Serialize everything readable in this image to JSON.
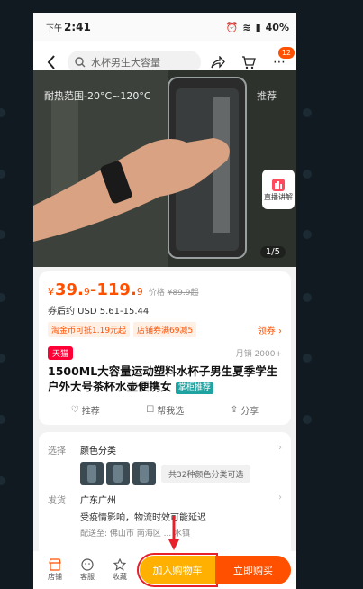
{
  "status_bar": {
    "ampm": "下午",
    "time": "2:41",
    "battery": "40%"
  },
  "nav": {
    "search_placeholder": "水杯男生大容量",
    "cart_badge": "12"
  },
  "hero": {
    "overlay_text": "耐热范围-20°C~120°C",
    "overlay_tab": "推荐",
    "counter": "1/5",
    "live_label": "直播讲解"
  },
  "price": {
    "currency": "¥",
    "low": "39.",
    "low_dec": "9",
    "sep": "-",
    "high": "119.",
    "high_dec": "9",
    "orig_label": "价格",
    "orig_price": "¥89.9起",
    "after_coupon": "券后约 USD 5.61-15.44"
  },
  "coupons": [
    "淘金币可抵1.19元起",
    "店铺券满69减5"
  ],
  "coupon_get": "领券 ›",
  "tmall": "天猫",
  "monthly_sales": "月销 2000+",
  "title": "1500ML大容量运动塑料水杯子男生夏季学生户外大号茶杯水壶便携女",
  "title_tag": "掌柜推荐",
  "actions": [
    "推荐",
    "帮我选",
    "分享"
  ],
  "details": {
    "select_label": "选择",
    "select_value": "颜色分类",
    "more_colors": "共32种颜色分类可选",
    "ship_label": "发货",
    "ship_value": "广东广州",
    "notice": "受疫情影响，物流时效可能延迟",
    "ship_to": "配送至: 佛山市 南海区 ... 水镇"
  },
  "bottom": {
    "store": "店铺",
    "service": "客服",
    "favorite": "收藏",
    "add_to_cart": "加入购物车",
    "buy_now": "立即购买"
  },
  "colors": {
    "accent": "#ff5000",
    "cart": "#ffb000",
    "tmall": "#ff0036",
    "tag": "#1fa3a1"
  }
}
